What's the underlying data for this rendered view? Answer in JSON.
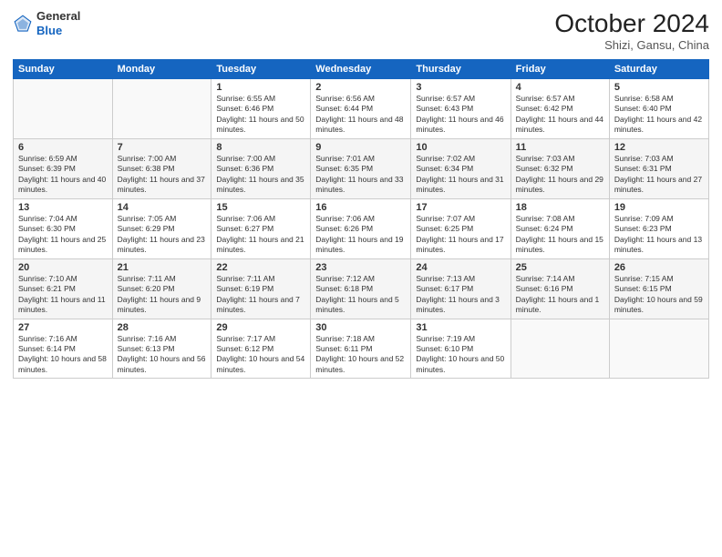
{
  "header": {
    "logo_line1": "General",
    "logo_line2": "Blue",
    "month_title": "October 2024",
    "location": "Shizi, Gansu, China"
  },
  "weekdays": [
    "Sunday",
    "Monday",
    "Tuesday",
    "Wednesday",
    "Thursday",
    "Friday",
    "Saturday"
  ],
  "weeks": [
    [
      {
        "day": "",
        "sunrise": "",
        "sunset": "",
        "daylight": "",
        "empty": true
      },
      {
        "day": "",
        "sunrise": "",
        "sunset": "",
        "daylight": "",
        "empty": true
      },
      {
        "day": "1",
        "sunrise": "Sunrise: 6:55 AM",
        "sunset": "Sunset: 6:46 PM",
        "daylight": "Daylight: 11 hours and 50 minutes."
      },
      {
        "day": "2",
        "sunrise": "Sunrise: 6:56 AM",
        "sunset": "Sunset: 6:44 PM",
        "daylight": "Daylight: 11 hours and 48 minutes."
      },
      {
        "day": "3",
        "sunrise": "Sunrise: 6:57 AM",
        "sunset": "Sunset: 6:43 PM",
        "daylight": "Daylight: 11 hours and 46 minutes."
      },
      {
        "day": "4",
        "sunrise": "Sunrise: 6:57 AM",
        "sunset": "Sunset: 6:42 PM",
        "daylight": "Daylight: 11 hours and 44 minutes."
      },
      {
        "day": "5",
        "sunrise": "Sunrise: 6:58 AM",
        "sunset": "Sunset: 6:40 PM",
        "daylight": "Daylight: 11 hours and 42 minutes."
      }
    ],
    [
      {
        "day": "6",
        "sunrise": "Sunrise: 6:59 AM",
        "sunset": "Sunset: 6:39 PM",
        "daylight": "Daylight: 11 hours and 40 minutes."
      },
      {
        "day": "7",
        "sunrise": "Sunrise: 7:00 AM",
        "sunset": "Sunset: 6:38 PM",
        "daylight": "Daylight: 11 hours and 37 minutes."
      },
      {
        "day": "8",
        "sunrise": "Sunrise: 7:00 AM",
        "sunset": "Sunset: 6:36 PM",
        "daylight": "Daylight: 11 hours and 35 minutes."
      },
      {
        "day": "9",
        "sunrise": "Sunrise: 7:01 AM",
        "sunset": "Sunset: 6:35 PM",
        "daylight": "Daylight: 11 hours and 33 minutes."
      },
      {
        "day": "10",
        "sunrise": "Sunrise: 7:02 AM",
        "sunset": "Sunset: 6:34 PM",
        "daylight": "Daylight: 11 hours and 31 minutes."
      },
      {
        "day": "11",
        "sunrise": "Sunrise: 7:03 AM",
        "sunset": "Sunset: 6:32 PM",
        "daylight": "Daylight: 11 hours and 29 minutes."
      },
      {
        "day": "12",
        "sunrise": "Sunrise: 7:03 AM",
        "sunset": "Sunset: 6:31 PM",
        "daylight": "Daylight: 11 hours and 27 minutes."
      }
    ],
    [
      {
        "day": "13",
        "sunrise": "Sunrise: 7:04 AM",
        "sunset": "Sunset: 6:30 PM",
        "daylight": "Daylight: 11 hours and 25 minutes."
      },
      {
        "day": "14",
        "sunrise": "Sunrise: 7:05 AM",
        "sunset": "Sunset: 6:29 PM",
        "daylight": "Daylight: 11 hours and 23 minutes."
      },
      {
        "day": "15",
        "sunrise": "Sunrise: 7:06 AM",
        "sunset": "Sunset: 6:27 PM",
        "daylight": "Daylight: 11 hours and 21 minutes."
      },
      {
        "day": "16",
        "sunrise": "Sunrise: 7:06 AM",
        "sunset": "Sunset: 6:26 PM",
        "daylight": "Daylight: 11 hours and 19 minutes."
      },
      {
        "day": "17",
        "sunrise": "Sunrise: 7:07 AM",
        "sunset": "Sunset: 6:25 PM",
        "daylight": "Daylight: 11 hours and 17 minutes."
      },
      {
        "day": "18",
        "sunrise": "Sunrise: 7:08 AM",
        "sunset": "Sunset: 6:24 PM",
        "daylight": "Daylight: 11 hours and 15 minutes."
      },
      {
        "day": "19",
        "sunrise": "Sunrise: 7:09 AM",
        "sunset": "Sunset: 6:23 PM",
        "daylight": "Daylight: 11 hours and 13 minutes."
      }
    ],
    [
      {
        "day": "20",
        "sunrise": "Sunrise: 7:10 AM",
        "sunset": "Sunset: 6:21 PM",
        "daylight": "Daylight: 11 hours and 11 minutes."
      },
      {
        "day": "21",
        "sunrise": "Sunrise: 7:11 AM",
        "sunset": "Sunset: 6:20 PM",
        "daylight": "Daylight: 11 hours and 9 minutes."
      },
      {
        "day": "22",
        "sunrise": "Sunrise: 7:11 AM",
        "sunset": "Sunset: 6:19 PM",
        "daylight": "Daylight: 11 hours and 7 minutes."
      },
      {
        "day": "23",
        "sunrise": "Sunrise: 7:12 AM",
        "sunset": "Sunset: 6:18 PM",
        "daylight": "Daylight: 11 hours and 5 minutes."
      },
      {
        "day": "24",
        "sunrise": "Sunrise: 7:13 AM",
        "sunset": "Sunset: 6:17 PM",
        "daylight": "Daylight: 11 hours and 3 minutes."
      },
      {
        "day": "25",
        "sunrise": "Sunrise: 7:14 AM",
        "sunset": "Sunset: 6:16 PM",
        "daylight": "Daylight: 11 hours and 1 minute."
      },
      {
        "day": "26",
        "sunrise": "Sunrise: 7:15 AM",
        "sunset": "Sunset: 6:15 PM",
        "daylight": "Daylight: 10 hours and 59 minutes."
      }
    ],
    [
      {
        "day": "27",
        "sunrise": "Sunrise: 7:16 AM",
        "sunset": "Sunset: 6:14 PM",
        "daylight": "Daylight: 10 hours and 58 minutes."
      },
      {
        "day": "28",
        "sunrise": "Sunrise: 7:16 AM",
        "sunset": "Sunset: 6:13 PM",
        "daylight": "Daylight: 10 hours and 56 minutes."
      },
      {
        "day": "29",
        "sunrise": "Sunrise: 7:17 AM",
        "sunset": "Sunset: 6:12 PM",
        "daylight": "Daylight: 10 hours and 54 minutes."
      },
      {
        "day": "30",
        "sunrise": "Sunrise: 7:18 AM",
        "sunset": "Sunset: 6:11 PM",
        "daylight": "Daylight: 10 hours and 52 minutes."
      },
      {
        "day": "31",
        "sunrise": "Sunrise: 7:19 AM",
        "sunset": "Sunset: 6:10 PM",
        "daylight": "Daylight: 10 hours and 50 minutes."
      },
      {
        "day": "",
        "sunrise": "",
        "sunset": "",
        "daylight": "",
        "empty": true
      },
      {
        "day": "",
        "sunrise": "",
        "sunset": "",
        "daylight": "",
        "empty": true
      }
    ]
  ]
}
